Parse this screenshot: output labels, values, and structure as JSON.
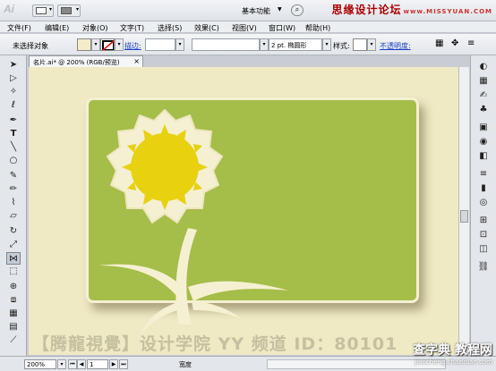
{
  "app": {
    "logo": "Ai",
    "workspace": "基本功能"
  },
  "watermark_top": {
    "main": "思缘设计论坛",
    "url": "www.MISSYUAN.COM"
  },
  "menu": [
    "文件(F)",
    "编辑(E)",
    "对象(O)",
    "文字(T)",
    "选择(S)",
    "效果(C)",
    "视图(V)",
    "窗口(W)",
    "帮助(H)"
  ],
  "control": {
    "selection": "未选择对象",
    "stroke_label": "描边:",
    "brush": "2 pt. 椭圆形",
    "style_label": "样式:",
    "opacity_label": "不透明度:"
  },
  "document": {
    "tab": "名片.ai* @ 200% (RGB/预览)"
  },
  "status": {
    "zoom": "200%",
    "page": "1",
    "info": "宽度"
  },
  "overlay_text": "【腾龍視覺】设计学院 YY 频道 ID：80101",
  "site": {
    "big": "查字典 教程网",
    "small": "jiaocheng.chazidian.com"
  },
  "colors": {
    "card": "#a5bd49",
    "artboard": "#efe9c4",
    "flower_center": "#e8d10e",
    "petals": "#f5f0d2"
  },
  "icons": {
    "tools": [
      "selection-icon",
      "direct-selection-icon",
      "magic-wand-icon",
      "lasso-icon",
      "pen-icon",
      "type-icon",
      "line-icon",
      "ellipse-icon",
      "paintbrush-icon",
      "pencil-icon",
      "blob-brush-icon",
      "eraser-icon",
      "rotate-icon",
      "scale-icon",
      "width-icon",
      "free-transform-icon",
      "shape-builder-icon",
      "perspective-icon",
      "mesh-icon",
      "gradient-icon",
      "eyedropper-icon",
      "blend-icon",
      "symbol-sprayer-icon",
      "graph-icon",
      "artboard-icon",
      "slice-icon",
      "hand-icon",
      "zoom-icon"
    ],
    "panels": [
      "color-icon",
      "swatches-icon",
      "brushes-icon",
      "symbols-icon",
      "graphic-styles-icon",
      "appearance-icon",
      "layers-icon",
      "stroke-icon",
      "gradient-panel-icon",
      "transparency-icon",
      "align-icon",
      "transform-icon",
      "pathfinder-icon",
      "links-icon"
    ]
  }
}
